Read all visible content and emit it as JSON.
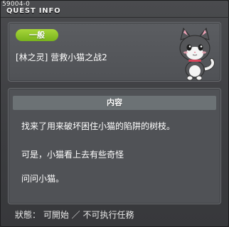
{
  "quest_id": "59004-0",
  "window_title": "QUEST INFO",
  "header": {
    "badge": "一般",
    "quest_name": "[林之灵] 营救小猫之战2",
    "npc_icon": "cat-npc-icon"
  },
  "content": {
    "header": "内容",
    "lines": [
      "找来了用来破坏困住小猫的陷阱的树枝。",
      "可是，小猫看上去有些奇怪",
      "问问小猫。"
    ]
  },
  "status": "狀態： 可開始 ／ 不可执行任務",
  "colors": {
    "badge_green": "#8cc52a",
    "panel": "#505256",
    "content_header": "#6c7275"
  }
}
